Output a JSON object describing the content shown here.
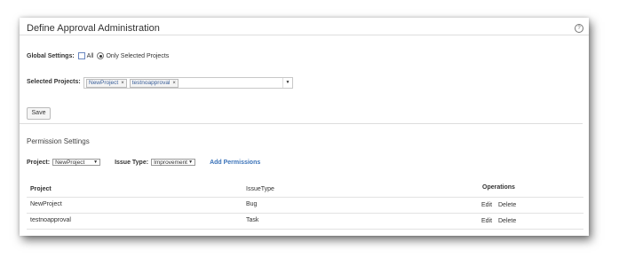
{
  "title": "Define Approval Administration",
  "help_icon": "?",
  "global_settings": {
    "label": "Global Settings:",
    "all_label": "All",
    "only_label": "Only Selected Projects"
  },
  "selected_projects": {
    "label": "Selected Projects:",
    "chips": [
      "NewProject",
      "testnoapproval"
    ],
    "remove_glyph": "×",
    "dropdown_glyph": "▼"
  },
  "save_label": "Save",
  "permission_settings": {
    "title": "Permission Settings",
    "project_label": "Project:",
    "project_value": "NewProject",
    "issue_type_label": "Issue Type:",
    "issue_type_value": "Improvement",
    "select_glyph": "▼",
    "add_label": "Add Permissions"
  },
  "table": {
    "headers": [
      "Project",
      "IssueType",
      "Operations"
    ],
    "rows": [
      {
        "project": "NewProject",
        "issue_type": "Bug",
        "edit": "Edit",
        "delete": "Delete"
      },
      {
        "project": "testnoapproval",
        "issue_type": "Task",
        "edit": "Edit",
        "delete": "Delete"
      }
    ]
  }
}
